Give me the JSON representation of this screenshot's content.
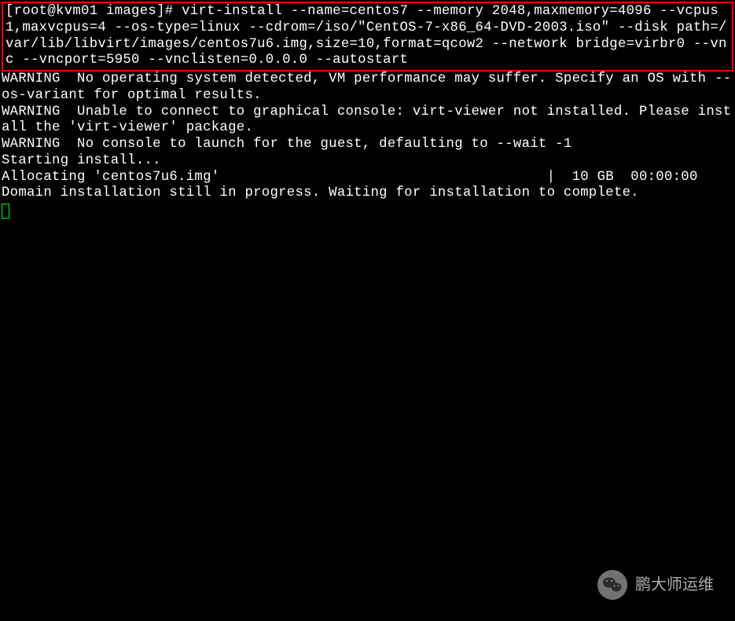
{
  "terminal": {
    "prompt_user": "[root@kvm01 images]# ",
    "command": "virt-install --name=centos7 --memory 2048,maxmemory=4096 --vcpus 1,maxvcpus=4 --os-type=linux --cdrom=/iso/\"CentOS-7-x86_64-DVD-2003.iso\" --disk path=/var/lib/libvirt/images/centos7u6.img,size=10,format=qcow2 --network bridge=virbr0 --vnc --vncport=5950 --vnclisten=0.0.0.0 --autostart",
    "warning1": "WARNING  No operating system detected, VM performance may suffer. Specify an OS with --os-variant for optimal results.",
    "warning2": "WARNING  Unable to connect to graphical console: virt-viewer not installed. Please install the 'virt-viewer' package.",
    "warning3": "WARNING  No console to launch for the guest, defaulting to --wait -1",
    "blank": "",
    "starting": "Starting install...",
    "allocating": "Allocating 'centos7u6.img'                                       |  10 GB  00:00:00",
    "domain_msg": "Domain installation still in progress. Waiting for installation to complete."
  },
  "watermark": {
    "text": "鹏大师运维"
  }
}
